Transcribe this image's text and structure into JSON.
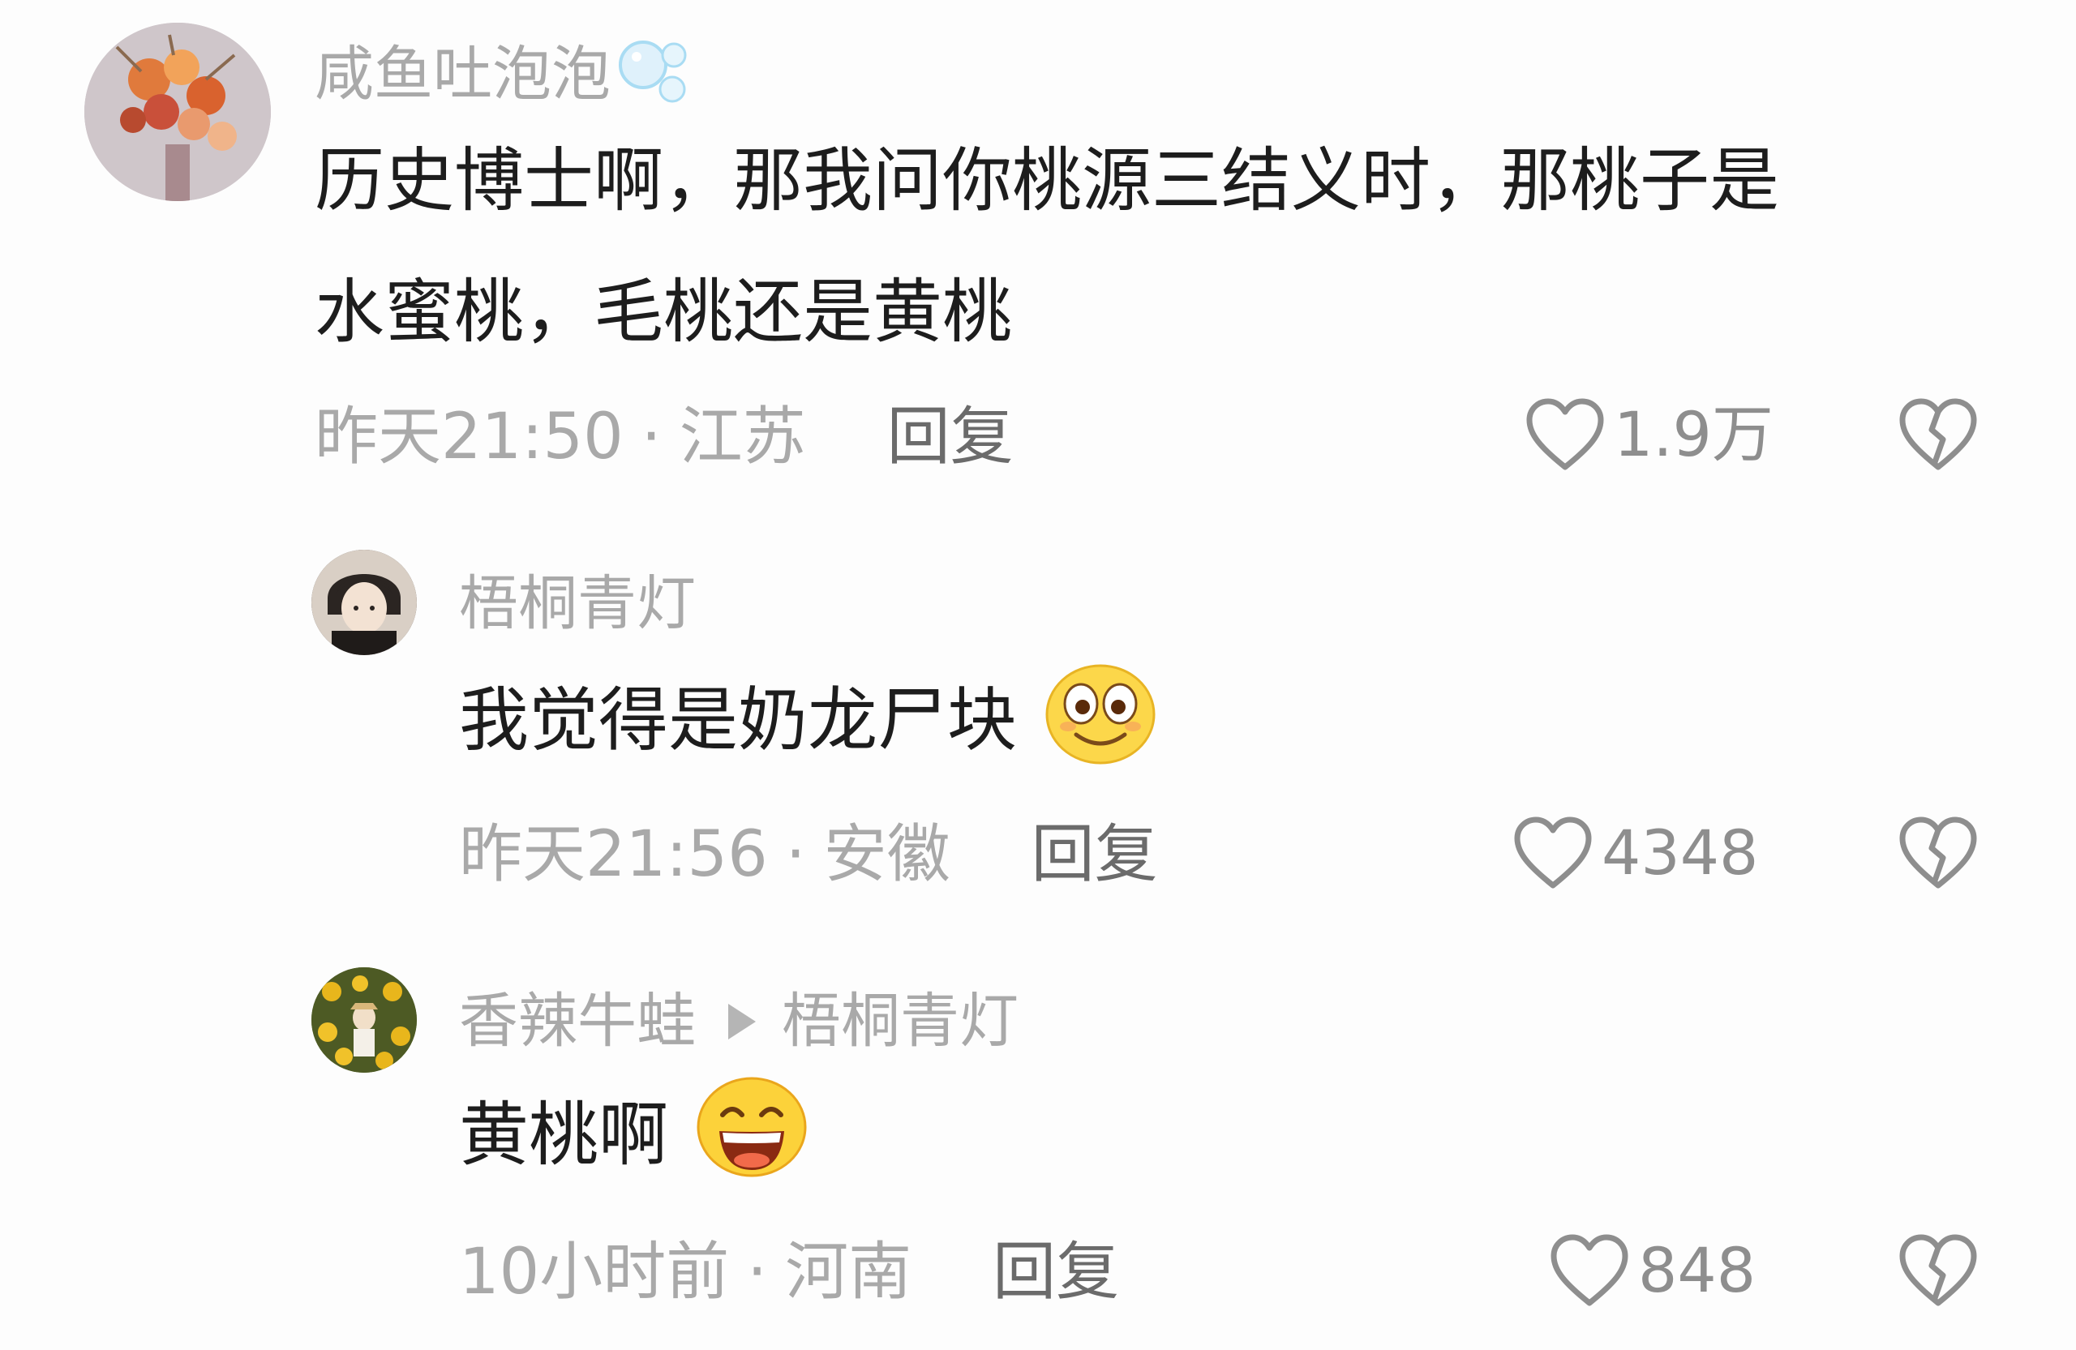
{
  "comments": [
    {
      "username": "咸鱼吐泡泡",
      "username_emoji": "bubbles-emoji",
      "text_line1": "历史博士啊，那我问你桃源三结义时，那桃子是",
      "text_line2": "水蜜桃，毛桃还是黄桃",
      "time": "昨天21:50",
      "location": "江苏",
      "reply_label": "回复",
      "likes": "1.9万",
      "avatar": "flower-bouquet-avatar"
    },
    {
      "username": "梧桐青灯",
      "text": "我觉得是奶龙尸块",
      "text_emoji": "wide-eyed-smile-emoji",
      "time": "昨天21:56",
      "location": "安徽",
      "reply_label": "回复",
      "likes": "4348",
      "avatar": "anime-boy-avatar"
    },
    {
      "username": "香辣牛蛙",
      "reply_to": "梧桐青灯",
      "text": "黄桃啊",
      "text_emoji": "grinning-emoji",
      "time": "10小时前",
      "location": "河南",
      "reply_label": "回复",
      "likes": "848",
      "avatar": "sunflower-field-avatar"
    }
  ],
  "separator": "·",
  "colors": {
    "background": "#fdfdfd",
    "text_primary": "#1d1d1d",
    "text_secondary": "#a9a9a9",
    "reply": "#6b6b6b",
    "icon": "#8e8e8e"
  }
}
